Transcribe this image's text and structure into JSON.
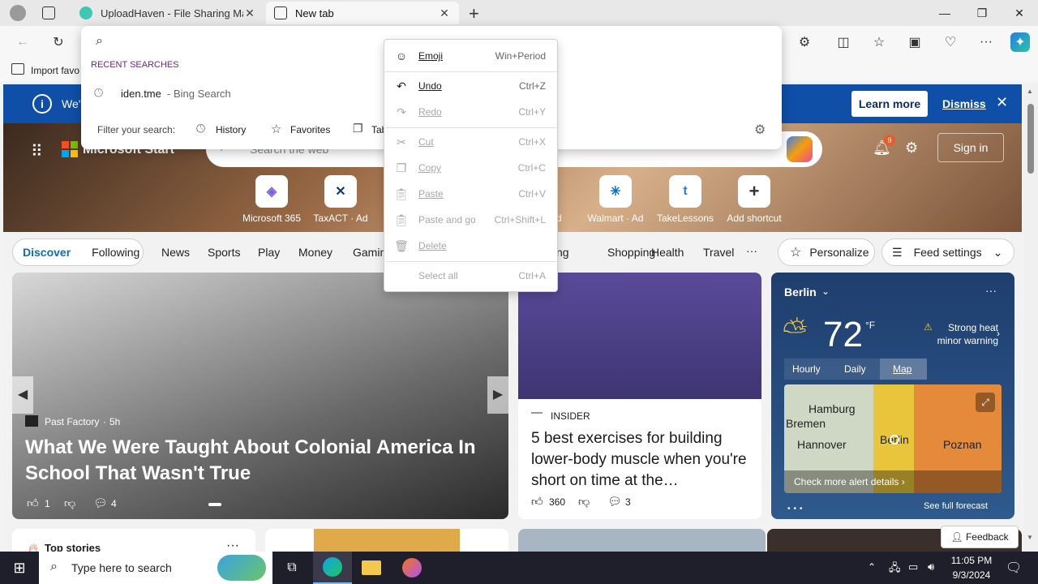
{
  "browser": {
    "tabs": [
      {
        "title": "UploadHaven - File Sharing Made"
      },
      {
        "title": "New tab"
      }
    ],
    "favorites_bar": {
      "import": "Import favo"
    }
  },
  "address_dropdown": {
    "recent_header": "RECENT SEARCHES",
    "recent_item": "iden.tme",
    "recent_item_suffix": "- Bing Search",
    "filter_label": "Filter your search:",
    "filters": [
      "History",
      "Favorites",
      "Tab"
    ]
  },
  "context_menu": {
    "items": [
      {
        "label": "Emoji",
        "shortcut": "Win+Period",
        "enabled": true
      },
      {
        "label": "Undo",
        "shortcut": "Ctrl+Z",
        "enabled": true
      },
      {
        "label": "Redo",
        "shortcut": "Ctrl+Y",
        "enabled": false
      },
      {
        "label": "Cut",
        "shortcut": "Ctrl+X",
        "enabled": false
      },
      {
        "label": "Copy",
        "shortcut": "Ctrl+C",
        "enabled": false
      },
      {
        "label": "Paste",
        "shortcut": "Ctrl+V",
        "enabled": false
      },
      {
        "label": "Paste and go",
        "shortcut": "Ctrl+Shift+L",
        "enabled": false
      },
      {
        "label": "Delete",
        "shortcut": "",
        "enabled": false
      },
      {
        "label": "Select all",
        "shortcut": "Ctrl+A",
        "enabled": false
      }
    ]
  },
  "banner": {
    "text": "We'",
    "learn_more": "Learn more",
    "dismiss": "Dismiss"
  },
  "header": {
    "brand": "Microsoft Start",
    "search_placeholder": "Search the web",
    "notif_count": "9",
    "sign_in": "Sign in"
  },
  "shortcuts": [
    {
      "label": "Microsoft 365",
      "glyph": "◈"
    },
    {
      "label": "TaxACT · Ad",
      "glyph": "✕"
    },
    {
      "label": "· Ad",
      "glyph": ""
    },
    {
      "label": "Walmart · Ad",
      "glyph": "✳"
    },
    {
      "label": "TakeLessons",
      "glyph": "t"
    },
    {
      "label": "Add shortcut",
      "glyph": "+"
    }
  ],
  "nav": {
    "discover": "Discover",
    "following": "Following",
    "items": [
      "News",
      "Sports",
      "Play",
      "Money",
      "Gamin"
    ],
    "items_right": [
      "ng",
      "Shopping",
      "Health",
      "Travel",
      "···"
    ],
    "personalize": "Personalize",
    "feed_settings": "Feed settings"
  },
  "hero_article": {
    "source": "Past Factory",
    "age": "5h",
    "title": "What We Were Taught About Colonial America In School That Wasn't True",
    "likes": "1",
    "comments": "4"
  },
  "insider_article": {
    "source": "INSIDER",
    "title": "5 best exercises for building lower-body muscle when you're short on time at the…",
    "likes": "360",
    "comments": "3"
  },
  "weather": {
    "city": "Berlin",
    "temp": "72",
    "unit": "°F",
    "alert": "Strong heat minor warning",
    "tabs": [
      "Hourly",
      "Daily",
      "Map"
    ],
    "map_labels": [
      "Hamburg",
      "Bremen",
      "Hannover",
      "Berlin",
      "Poznan"
    ],
    "alert_link": "Check more alert details",
    "forecast_link": "See full forecast"
  },
  "bottom": {
    "top_stories": "Top stories",
    "feedback": "Feedback"
  },
  "taskbar": {
    "search_placeholder": "Type here to search",
    "time": "11:05 PM",
    "date": "9/3/2024"
  },
  "colors": {
    "banner": "#0f4fa8",
    "accent": "#0f6cbd",
    "taskbar": "#1f1f2b"
  }
}
